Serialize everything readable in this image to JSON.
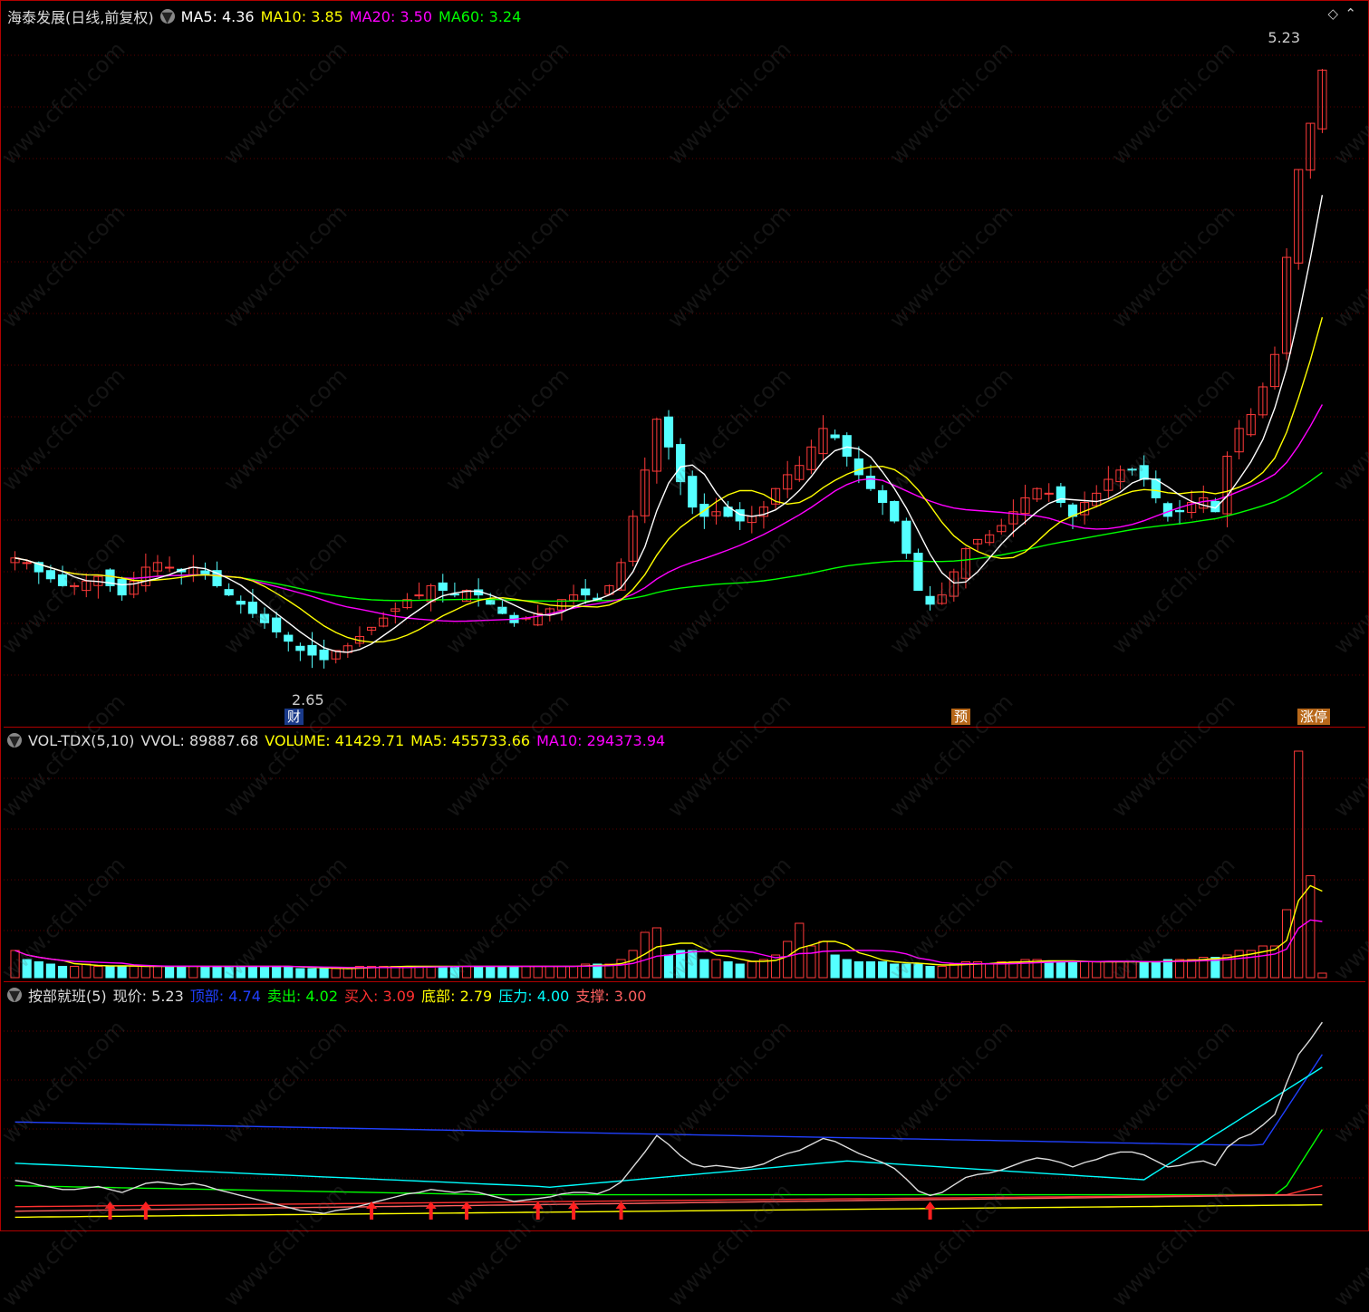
{
  "main_panel": {
    "stock_name": "海泰发展(日线,前复权)",
    "ma_items": [
      {
        "label": "MA5: 4.36",
        "color": "#ffffff"
      },
      {
        "label": "MA10: 3.85",
        "color": "#ffff00"
      },
      {
        "label": "MA20: 3.50",
        "color": "#ff00ff"
      },
      {
        "label": "MA60: 3.24",
        "color": "#00ff00"
      }
    ],
    "high_label": "5.23",
    "low_label": "2.65",
    "badges": {
      "cai": "财",
      "yu": "预",
      "zhang": "涨停"
    }
  },
  "volume_panel": {
    "indicator": "VOL-TDX(5,10)",
    "items": [
      {
        "label": "VVOL: 89887.68",
        "color": "#dddddd"
      },
      {
        "label": "VOLUME: 41429.71",
        "color": "#ffff00"
      },
      {
        "label": "MA5: 455733.66",
        "color": "#ffff00"
      },
      {
        "label": "MA10: 294373.94",
        "color": "#ff00ff"
      }
    ]
  },
  "indicator_panel": {
    "indicator": "按部就班(5)",
    "items": [
      {
        "label": "现价: 5.23",
        "color": "#dddddd"
      },
      {
        "label": "顶部: 4.74",
        "color": "#2040ff"
      },
      {
        "label": "卖出: 4.02",
        "color": "#00ff00"
      },
      {
        "label": "买入: 3.09",
        "color": "#ff3030"
      },
      {
        "label": "底部: 2.79",
        "color": "#ffff00"
      },
      {
        "label": "压力: 4.00",
        "color": "#00ffff"
      },
      {
        "label": "支撑: 3.00",
        "color": "#ff6060"
      }
    ]
  },
  "watermark": "www.cfchi.com",
  "chart_data": [
    {
      "type": "candlestick",
      "title": "海泰发展(日线,前复权)",
      "ylim": [
        2.5,
        5.4
      ],
      "series": [
        {
          "name": "MA5",
          "color": "#ffffff"
        },
        {
          "name": "MA10",
          "color": "#ffff00"
        },
        {
          "name": "MA20",
          "color": "#ff00ff"
        },
        {
          "name": "MA60",
          "color": "#00ff00"
        }
      ],
      "close": [
        3.12,
        3.1,
        3.06,
        3.03,
        3.0,
        3.0,
        3.02,
        3.04,
        3.0,
        2.96,
        3.02,
        3.08,
        3.1,
        3.08,
        3.06,
        3.08,
        3.05,
        3.0,
        2.96,
        2.92,
        2.88,
        2.84,
        2.8,
        2.76,
        2.72,
        2.7,
        2.68,
        2.72,
        2.74,
        2.78,
        2.82,
        2.86,
        2.9,
        2.94,
        2.96,
        3.0,
        2.98,
        2.96,
        2.98,
        2.96,
        2.92,
        2.88,
        2.84,
        2.86,
        2.88,
        2.9,
        2.94,
        2.96,
        2.96,
        2.94,
        3.0,
        3.1,
        3.3,
        3.5,
        3.72,
        3.6,
        3.45,
        3.34,
        3.3,
        3.32,
        3.3,
        3.28,
        3.3,
        3.34,
        3.42,
        3.48,
        3.52,
        3.6,
        3.68,
        3.64,
        3.56,
        3.48,
        3.42,
        3.36,
        3.28,
        3.14,
        2.98,
        2.92,
        2.96,
        3.06,
        3.16,
        3.2,
        3.22,
        3.26,
        3.32,
        3.38,
        3.42,
        3.4,
        3.36,
        3.3,
        3.36,
        3.4,
        3.46,
        3.5,
        3.5,
        3.46,
        3.38,
        3.3,
        3.32,
        3.36,
        3.38,
        3.32,
        3.56,
        3.68,
        3.74,
        3.86,
        4.0,
        4.42,
        4.8,
        5.0,
        5.23
      ],
      "ma60_last": 3.24
    },
    {
      "type": "bar",
      "title": "VOL-TDX(5,10)",
      "series": [
        {
          "name": "VOLUME",
          "color": "#ffff00"
        },
        {
          "name": "MA5",
          "color": "#ffff00"
        },
        {
          "name": "MA10",
          "color": "#ff00ff"
        }
      ],
      "values_rel": [
        0.12,
        0.08,
        0.07,
        0.06,
        0.05,
        0.05,
        0.06,
        0.05,
        0.05,
        0.05,
        0.05,
        0.05,
        0.05,
        0.05,
        0.05,
        0.05,
        0.05,
        0.05,
        0.05,
        0.05,
        0.05,
        0.05,
        0.05,
        0.05,
        0.04,
        0.04,
        0.04,
        0.04,
        0.04,
        0.05,
        0.05,
        0.05,
        0.05,
        0.05,
        0.05,
        0.05,
        0.05,
        0.05,
        0.05,
        0.05,
        0.05,
        0.05,
        0.05,
        0.05,
        0.05,
        0.05,
        0.05,
        0.05,
        0.06,
        0.06,
        0.06,
        0.08,
        0.12,
        0.2,
        0.22,
        0.1,
        0.12,
        0.12,
        0.08,
        0.08,
        0.07,
        0.06,
        0.07,
        0.08,
        0.1,
        0.16,
        0.24,
        0.14,
        0.16,
        0.1,
        0.08,
        0.07,
        0.07,
        0.07,
        0.06,
        0.06,
        0.06,
        0.05,
        0.05,
        0.06,
        0.07,
        0.07,
        0.06,
        0.07,
        0.07,
        0.08,
        0.08,
        0.07,
        0.07,
        0.07,
        0.07,
        0.07,
        0.07,
        0.07,
        0.07,
        0.07,
        0.07,
        0.08,
        0.08,
        0.08,
        0.09,
        0.09,
        0.1,
        0.12,
        0.12,
        0.14,
        0.14,
        0.3,
        1.0,
        0.45,
        0.02
      ]
    },
    {
      "type": "line",
      "title": "按部就班(5)",
      "series": [
        {
          "name": "现价",
          "color": "#ffffff"
        },
        {
          "name": "顶部",
          "color": "#2040ff"
        },
        {
          "name": "卖出",
          "color": "#00ff00"
        },
        {
          "name": "买入",
          "color": "#ff3030"
        },
        {
          "name": "底部",
          "color": "#ffff00"
        },
        {
          "name": "压力",
          "color": "#00ffff"
        },
        {
          "name": "支撑",
          "color": "#ff6060"
        }
      ]
    }
  ]
}
